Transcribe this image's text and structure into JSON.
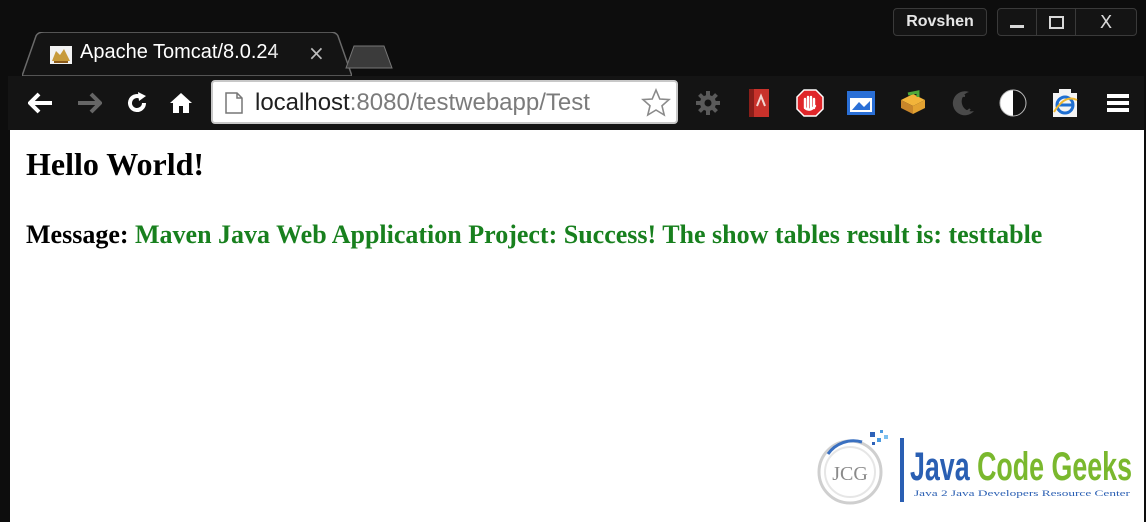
{
  "browser": {
    "profile_name": "Rovshen",
    "tab": {
      "title": "Apache Tomcat/8.0.24",
      "close": "×"
    },
    "address": {
      "host": "localhost",
      "rest": ":8080/testwebapp/Test"
    },
    "window_controls": {
      "close": "X"
    }
  },
  "page": {
    "heading": "Hello World!",
    "message_label": "Message: ",
    "message_value": "Maven Java Web Application Project: Success! The show tables result is: testtable"
  },
  "logo": {
    "badge": "JCG",
    "name": "Java Code Geeks",
    "tagline": "Java 2 Java Developers Resource Center"
  },
  "colors": {
    "accent_green": "#18801e",
    "chrome_dark": "#0d0d0d"
  }
}
